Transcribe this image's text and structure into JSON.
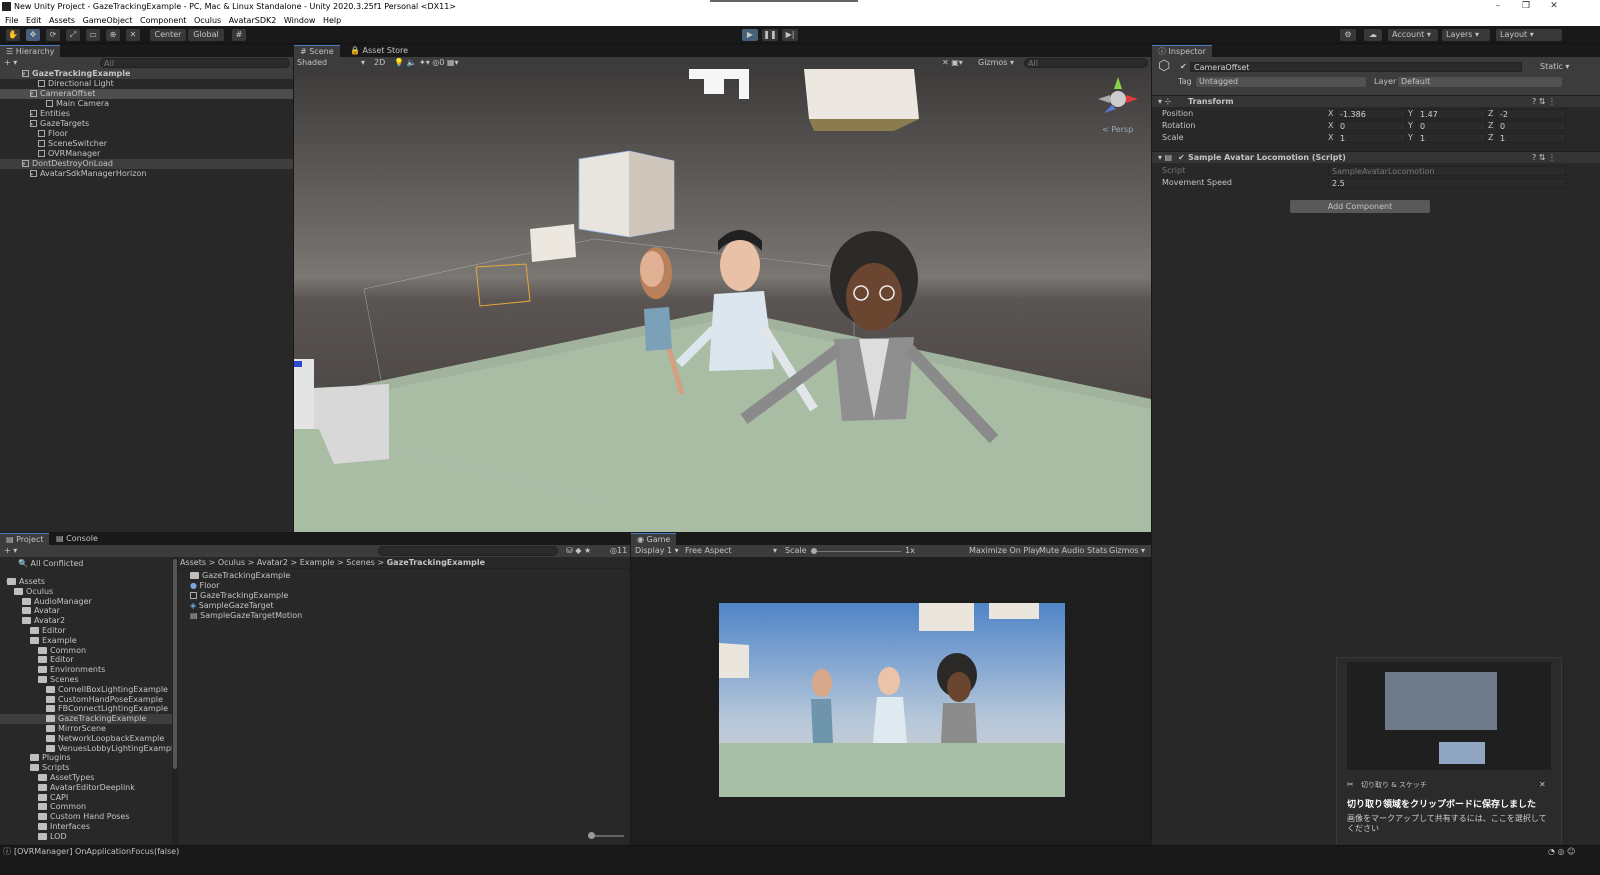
{
  "window": {
    "title": "New Unity Project - GazeTrackingExample - PC, Mac & Linux Standalone - Unity 2020.3.25f1 Personal <DX11>"
  },
  "menu": [
    "File",
    "Edit",
    "Assets",
    "GameObject",
    "Component",
    "Oculus",
    "AvatarSDK2",
    "Window",
    "Help"
  ],
  "toolbar": {
    "center_label": "Center",
    "global_label": "Global",
    "account_label": "Account",
    "layers_label": "Layers",
    "layout_label": "Layout"
  },
  "hierarchy": {
    "tab": "Hierarchy",
    "search_placeholder": "All",
    "items": [
      {
        "label": "GazeTrackingExample",
        "depth": 0,
        "kind": "scene"
      },
      {
        "label": "Directional Light",
        "depth": 1,
        "kind": "object"
      },
      {
        "label": "CameraOffset",
        "depth": 1,
        "kind": "object"
      },
      {
        "label": "Main Camera",
        "depth": 2,
        "kind": "object"
      },
      {
        "label": "Entities",
        "depth": 1,
        "kind": "object"
      },
      {
        "label": "GazeTargets",
        "depth": 1,
        "kind": "object"
      },
      {
        "label": "Floor",
        "depth": 1,
        "kind": "object"
      },
      {
        "label": "SceneSwitcher",
        "depth": 1,
        "kind": "object"
      },
      {
        "label": "OVRManager",
        "depth": 1,
        "kind": "object"
      },
      {
        "label": "DontDestroyOnLoad",
        "depth": 0,
        "kind": "scene"
      },
      {
        "label": "AvatarSdkManagerHorizon",
        "depth": 1,
        "kind": "object"
      }
    ]
  },
  "scene": {
    "tabs": [
      "Scene",
      "Asset Store"
    ],
    "shading": "Shaded",
    "mode_2d": "2D",
    "gizmos": "Gizmos",
    "search_placeholder": "All",
    "persp": "< Persp"
  },
  "inspector": {
    "tab": "Inspector",
    "object_name": "CameraOffset",
    "static_label": "Static",
    "tag_label": "Tag",
    "tag_value": "Untagged",
    "layer_label": "Layer",
    "layer_value": "Default",
    "transform": {
      "title": "Transform",
      "rows": [
        {
          "label": "Position",
          "x": "-1.386",
          "y": "1.47",
          "z": "-2"
        },
        {
          "label": "Rotation",
          "x": "0",
          "y": "0",
          "z": "0"
        },
        {
          "label": "Scale",
          "x": "1",
          "y": "1",
          "z": "1"
        }
      ]
    },
    "script_component": {
      "title": "Sample Avatar Locomotion (Script)",
      "script_label": "Script",
      "script_value": "SampleAvatarLocomotion",
      "speed_label": "Movement Speed",
      "speed_value": "2.5"
    },
    "add_component": "Add Component"
  },
  "project": {
    "tabs": [
      "Project",
      "Console"
    ],
    "all_conflicted": "All Conflicted",
    "tree": [
      {
        "label": "Assets",
        "depth": 0
      },
      {
        "label": "Oculus",
        "depth": 1
      },
      {
        "label": "AudioManager",
        "depth": 2
      },
      {
        "label": "Avatar",
        "depth": 2
      },
      {
        "label": "Avatar2",
        "depth": 2
      },
      {
        "label": "Editor",
        "depth": 3
      },
      {
        "label": "Example",
        "depth": 3
      },
      {
        "label": "Common",
        "depth": 4
      },
      {
        "label": "Editor",
        "depth": 4
      },
      {
        "label": "Environments",
        "depth": 4
      },
      {
        "label": "Scenes",
        "depth": 4
      },
      {
        "label": "CornellBoxLightingExample",
        "depth": 5
      },
      {
        "label": "CustomHandPoseExample",
        "depth": 5
      },
      {
        "label": "FBConnectLightingExample",
        "depth": 5
      },
      {
        "label": "GazeTrackingExample",
        "depth": 5
      },
      {
        "label": "MirrorScene",
        "depth": 5
      },
      {
        "label": "NetworkLoopbackExample",
        "depth": 5
      },
      {
        "label": "VenuesLobbyLightingExample",
        "depth": 5
      },
      {
        "label": "Plugins",
        "depth": 3
      },
      {
        "label": "Scripts",
        "depth": 3
      },
      {
        "label": "AssetTypes",
        "depth": 4
      },
      {
        "label": "AvatarEditorDeeplink",
        "depth": 4
      },
      {
        "label": "CAPI",
        "depth": 4
      },
      {
        "label": "Common",
        "depth": 4
      },
      {
        "label": "Custom Hand Poses",
        "depth": 4
      },
      {
        "label": "Interfaces",
        "depth": 4
      },
      {
        "label": "LOD",
        "depth": 4
      }
    ],
    "breadcrumb": [
      "Assets",
      "Oculus",
      "Avatar2",
      "Example",
      "Scenes",
      "GazeTrackingExample"
    ],
    "files": [
      {
        "label": "GazeTrackingExample",
        "kind": "folder"
      },
      {
        "label": "Floor",
        "kind": "material"
      },
      {
        "label": "GazeTrackingExample",
        "kind": "scene"
      },
      {
        "label": "SampleGazeTarget",
        "kind": "prefab"
      },
      {
        "label": "SampleGazeTargetMotion",
        "kind": "script"
      }
    ],
    "count": "11"
  },
  "game": {
    "tab": "Game",
    "display": "Display 1",
    "aspect": "Free Aspect",
    "scale_label": "Scale",
    "scale_value": "1x",
    "maximize": "Maximize On Play",
    "mute": "Mute Audio",
    "stats": "Stats",
    "gizmos": "Gizmos"
  },
  "notification": {
    "app": "切り取り & スケッチ",
    "title": "切り取り領域をクリップボードに保存しました",
    "body": "画像をマークアップして共有するには、ここを選択してください"
  },
  "status": {
    "message": "[OVRManager] OnApplicationFocus(false)"
  }
}
